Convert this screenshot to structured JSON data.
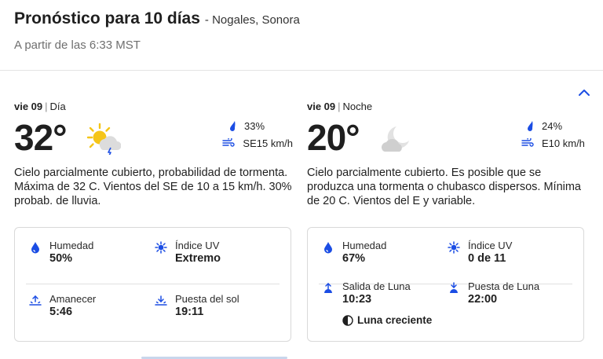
{
  "header": {
    "title": "Pronóstico para 10 días",
    "location": "- Nogales, Sonora",
    "subtitle": "A partir de las 6:33 MST"
  },
  "day": {
    "date": "vie 09",
    "separator": "|",
    "period": "Día",
    "temperature": "32°",
    "icon": "partly-cloudy-sun-storm-icon",
    "precip_chance": "33%",
    "wind": "SE15 km/h",
    "description": "Cielo parcialmente cubierto, probabilidad de tormenta. Máxima de 32 C. Vientos del SE de 10 a 15 km/h. 30% probab. de lluvia.",
    "humidity_label": "Humedad",
    "humidity_value": "50%",
    "uv_label": "Índice UV",
    "uv_value": "Extremo",
    "sunrise_label": "Amanecer",
    "sunrise_value": "5:46",
    "sunset_label": "Puesta del sol",
    "sunset_value": "19:11"
  },
  "night": {
    "date": "vie 09",
    "separator": "|",
    "period": "Noche",
    "temperature": "20°",
    "icon": "cloudy-moon-icon",
    "precip_chance": "24%",
    "wind": "E10 km/h",
    "description": "Cielo parcialmente cubierto. Es posible que se produzca una tormenta o chubasco dispersos. Mínima de 20 C. Vientos del E y variable.",
    "humidity_label": "Humedad",
    "humidity_value": "67%",
    "uv_label": "Índice UV",
    "uv_value": "0 de 11",
    "moonrise_label": "Salida de Luna",
    "moonrise_value": "10:23",
    "moonset_label": "Puesta de Luna",
    "moonset_value": "22:00",
    "moon_phase": "Luna creciente"
  },
  "colors": {
    "accent": "#1b4de4",
    "text": "#1f1f1f",
    "muted": "#6f6f6f",
    "sun": "#f5c518"
  }
}
